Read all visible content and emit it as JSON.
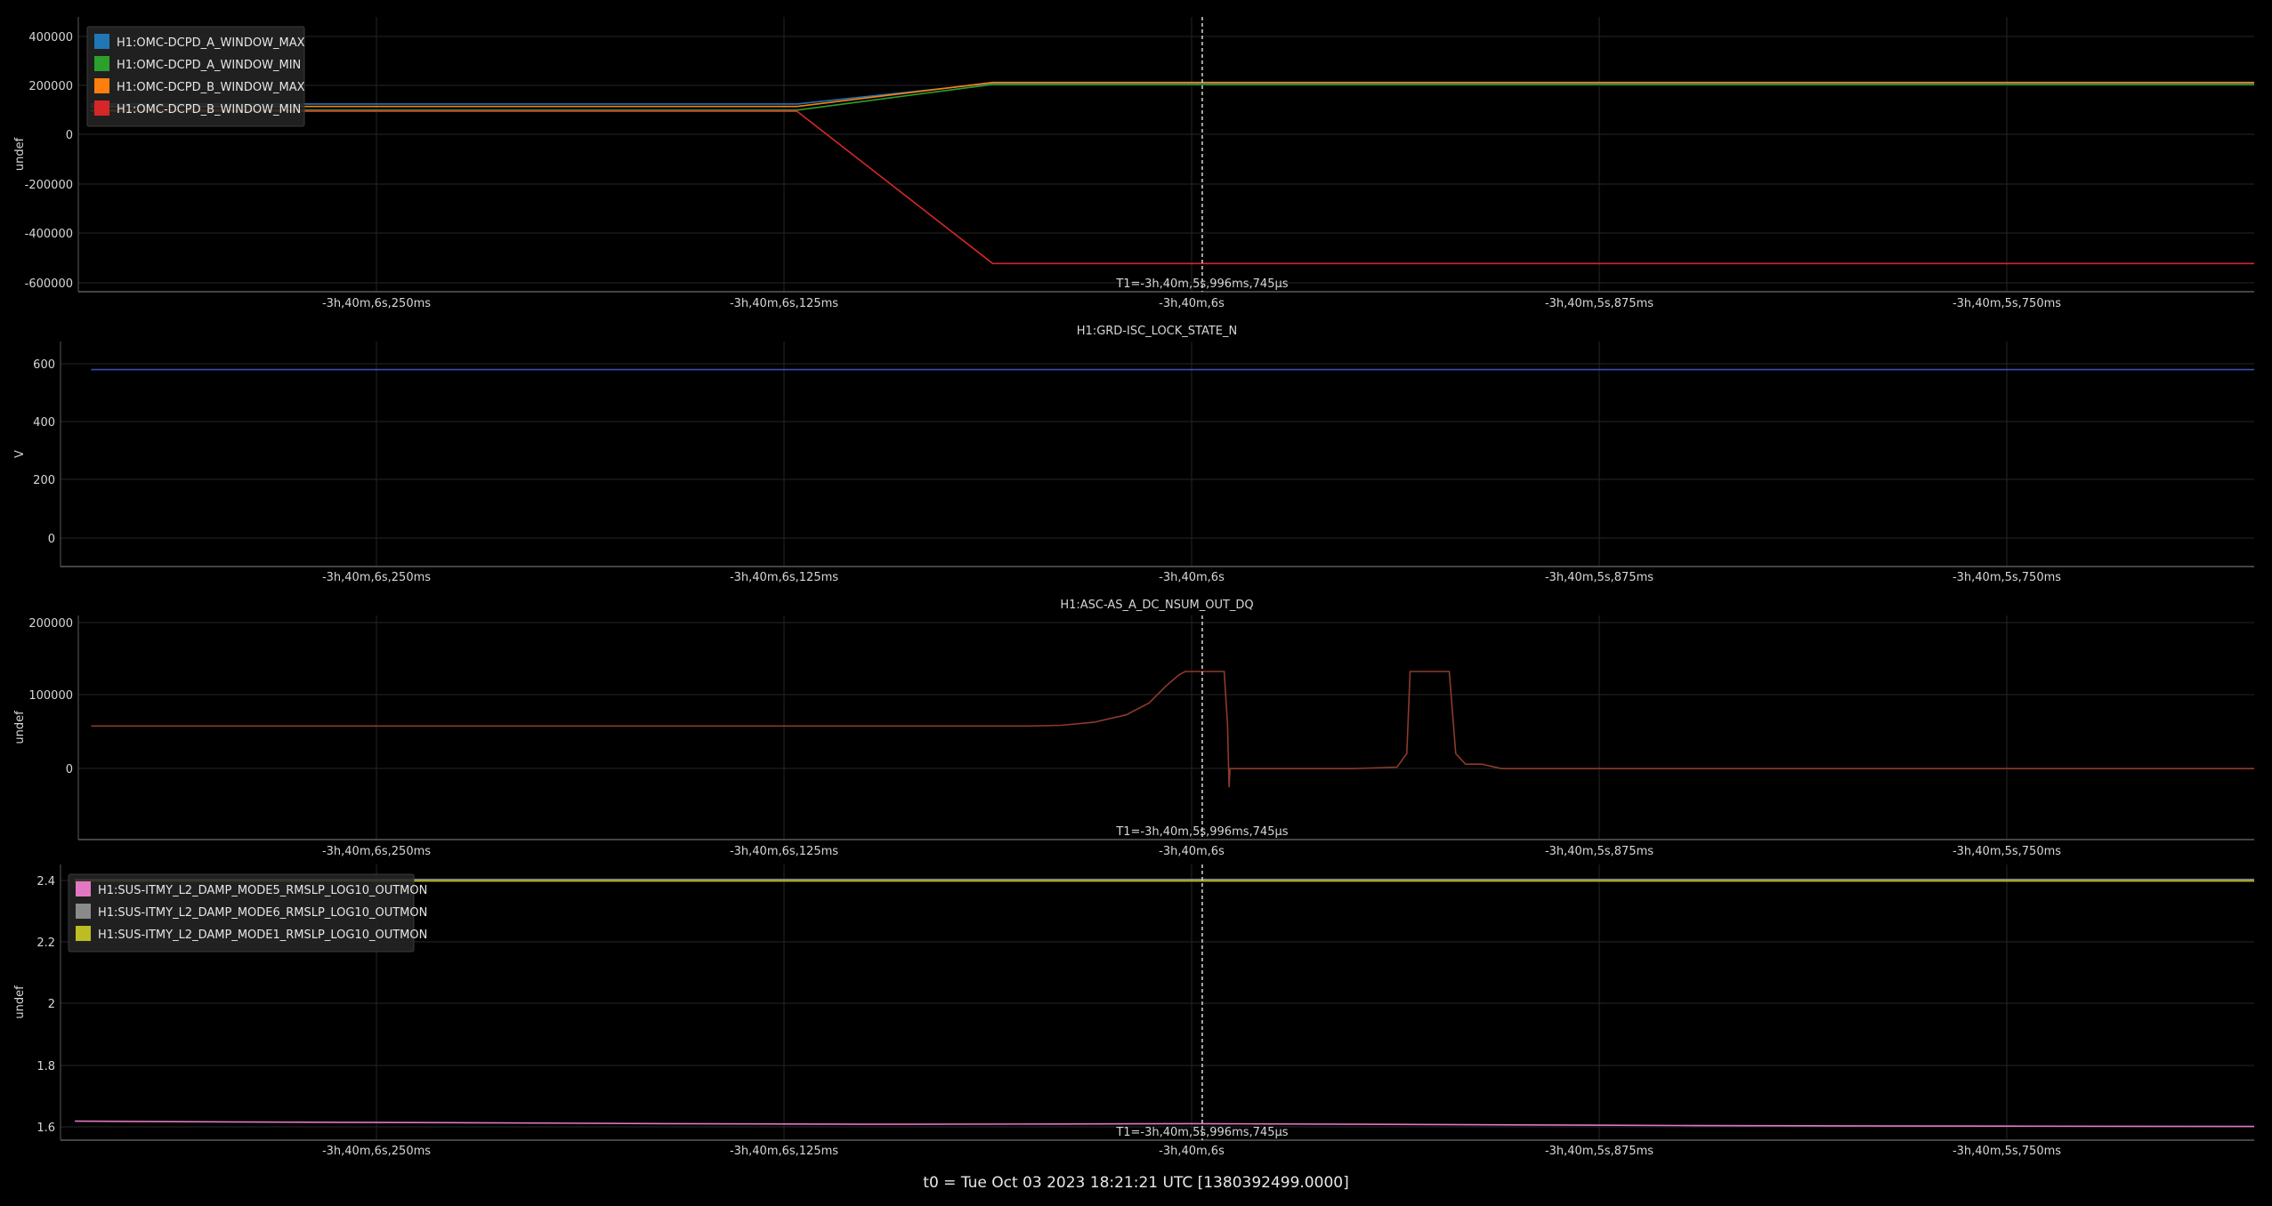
{
  "footer": "t0 = Tue Oct 03 2023 18:21:21 UTC [1380392499.0000]",
  "colors": {
    "background": "#000000",
    "grid": "#262626",
    "axis": "#5a5a5a",
    "text": "#d6d6d6",
    "cursor": "#d8d8d8"
  },
  "chart_data": [
    {
      "type": "line",
      "title": "",
      "ylabel": "undef",
      "xlabel": "",
      "x_ticks": [
        "-3h,40m,6s,250ms",
        "-3h,40m,6s,125ms",
        "-3h,40m,6s",
        "-3h,40m,5s,875ms",
        "-3h,40m,5s,750ms"
      ],
      "y_ticks": [
        "400000",
        "200000",
        "0",
        "-200000",
        "-400000",
        "-600000"
      ],
      "ylim": [
        -640000,
        480000
      ],
      "cursor_label": "T1=-3h,40m,5s,996ms,745µs",
      "legend_position": "top-left",
      "grid": true,
      "series": [
        {
          "name": "H1:OMC-DCPD_A_WINDOW_MAX",
          "color": "#1f77b4",
          "points": [
            [
              -6.3375,
              125000
            ],
            [
              -6.121,
              125000
            ],
            [
              -6.061,
              210000
            ],
            [
              -5.67,
              210000
            ]
          ]
        },
        {
          "name": "H1:OMC-DCPD_A_WINDOW_MIN",
          "color": "#2ca02c",
          "points": [
            [
              -6.3375,
              100000
            ],
            [
              -6.121,
              100000
            ],
            [
              -6.061,
              205000
            ],
            [
              -5.67,
              205000
            ]
          ]
        },
        {
          "name": "H1:OMC-DCPD_B_WINDOW_MAX",
          "color": "#ff7f0e",
          "points": [
            [
              -6.3375,
              115000
            ],
            [
              -6.121,
              115000
            ],
            [
              -6.061,
              213000
            ],
            [
              -5.67,
              213000
            ]
          ]
        },
        {
          "name": "H1:OMC-DCPD_B_WINDOW_MIN",
          "color": "#d62728",
          "points": [
            [
              -6.3375,
              95000
            ],
            [
              -6.121,
              95000
            ],
            [
              -6.061,
              -525000
            ],
            [
              -5.67,
              -525000
            ]
          ]
        }
      ]
    },
    {
      "type": "line",
      "title": "H1:GRD-ISC_LOCK_STATE_N",
      "ylabel": "V",
      "xlabel": "",
      "x_ticks": [
        "-3h,40m,6s,250ms",
        "-3h,40m,6s,125ms",
        "-3h,40m,6s",
        "-3h,40m,5s,875ms",
        "-3h,40m,5s,750ms"
      ],
      "y_ticks": [
        "600",
        "400",
        "200",
        "0"
      ],
      "ylim": [
        -100,
        700
      ],
      "cursor_label": "",
      "legend_position": "none",
      "grid": true,
      "series": [
        {
          "color": "#3a4fb0",
          "points": [
            [
              -6.3375,
              600
            ],
            [
              -5.67,
              600
            ]
          ]
        }
      ]
    },
    {
      "type": "line",
      "title": "H1:ASC-AS_A_DC_NSUM_OUT_DQ",
      "ylabel": "undef",
      "xlabel": "",
      "x_ticks": [
        "-3h,40m,6s,250ms",
        "-3h,40m,6s,125ms",
        "-3h,40m,6s",
        "-3h,40m,5s,875ms",
        "-3h,40m,5s,750ms"
      ],
      "y_ticks": [
        "200000",
        "100000",
        "0"
      ],
      "ylim": [
        -95000,
        205000
      ],
      "cursor_label": "T1=-3h,40m,5s,996ms,745µs",
      "legend_position": "none",
      "grid": true,
      "series": [
        {
          "color": "#8c3b2b",
          "points": [
            [
              -6.3375,
              57000
            ],
            [
              -6.05,
              57000
            ],
            [
              -6.04,
              58000
            ],
            [
              -6.03,
              62000
            ],
            [
              -6.02,
              72000
            ],
            [
              -6.013,
              88000
            ],
            [
              -6.008,
              110000
            ],
            [
              -6.004,
              125000
            ],
            [
              -6.002,
              130000
            ],
            [
              -5.99,
              130000
            ],
            [
              -5.989,
              60000
            ],
            [
              -5.9885,
              -25000
            ],
            [
              -5.9882,
              0
            ],
            [
              -5.95,
              0
            ],
            [
              -5.937,
              2000
            ],
            [
              -5.934,
              20000
            ],
            [
              -5.933,
              130000
            ],
            [
              -5.921,
              130000
            ],
            [
              -5.919,
              20000
            ],
            [
              -5.916,
              6000
            ],
            [
              -5.911,
              6000
            ],
            [
              -5.905,
              0
            ],
            [
              -5.67,
              0
            ]
          ]
        }
      ]
    },
    {
      "type": "line",
      "title": "",
      "ylabel": "undef",
      "xlabel": "",
      "x_ticks": [
        "-3h,40m,6s,250ms",
        "-3h,40m,6s,125ms",
        "-3h,40m,6s",
        "-3h,40m,5s,875ms",
        "-3h,40m,5s,750ms"
      ],
      "y_ticks": [
        "2.4",
        "2.2",
        "2",
        "1.8",
        "1.6"
      ],
      "ylim": [
        1.56,
        2.445
      ],
      "cursor_label": "T1=-3h,40m,5s,996ms,745µs",
      "legend_position": "top-left",
      "grid": true,
      "series": [
        {
          "name": "H1:SUS-ITMY_L2_DAMP_MODE5_RMSLP_LOG10_OUTMON",
          "color": "#e377c2",
          "points": [
            [
              -6.3425,
              1.621
            ],
            [
              -6.28,
              1.618
            ],
            [
              -6.22,
              1.616
            ],
            [
              -6.16,
              1.613
            ],
            [
              -6.1,
              1.611
            ],
            [
              -6.04,
              1.612
            ],
            [
              -6.0,
              1.613
            ],
            [
              -5.95,
              1.611
            ],
            [
              -5.9,
              1.609
            ],
            [
              -5.85,
              1.607
            ],
            [
              -5.8,
              1.606
            ],
            [
              -5.75,
              1.605
            ],
            [
              -5.67,
              1.604
            ]
          ]
        },
        {
          "name": "H1:SUS-ITMY_L2_DAMP_MODE6_RMSLP_LOG10_OUTMON",
          "color": "#8a8a8a",
          "points": [
            [
              -6.3425,
              2.397
            ],
            [
              -5.67,
              2.397
            ]
          ]
        },
        {
          "name": "H1:SUS-ITMY_L2_DAMP_MODE1_RMSLP_LOG10_OUTMON",
          "color": "#bcbd22",
          "points": [
            [
              -6.3425,
              2.392
            ],
            [
              -5.67,
              2.392
            ]
          ]
        }
      ]
    }
  ]
}
